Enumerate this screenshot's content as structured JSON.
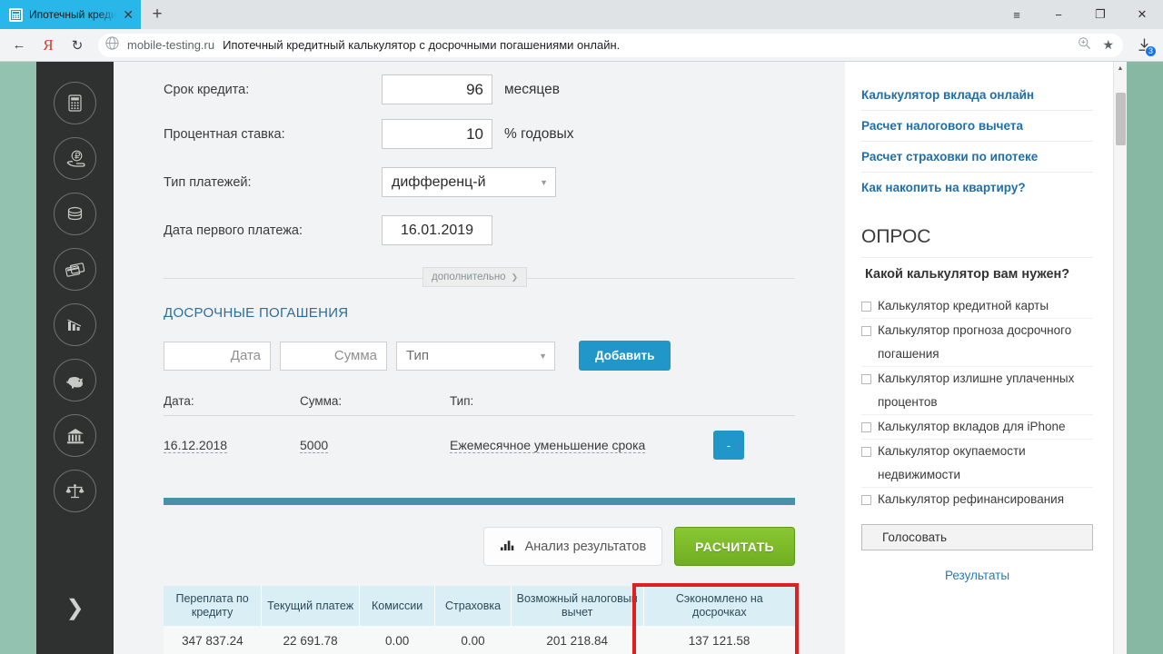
{
  "browser": {
    "tab": {
      "title": "Ипотечный кредитный",
      "favicon_icon": "calculator-icon",
      "close_icon": "✕"
    },
    "newtab_label": "+",
    "window_controls": {
      "menu": "≡",
      "minimize": "−",
      "maximize": "❐",
      "close": "✕"
    },
    "toolbar": {
      "back_icon": "←",
      "yandex_icon": "Я",
      "reload_icon": "↻",
      "site_icon": "globe-icon",
      "domain": "mobile-testing.ru",
      "page_title": "Ипотечный кредитный калькулятор с досрочными погашениями онлайн.",
      "zoom_icon": "search-plus-icon",
      "bookmark_icon": "★",
      "download_icon": "download-icon",
      "download_badge": "3"
    }
  },
  "rail": {
    "items": [
      {
        "icon": "calculator-icon"
      },
      {
        "icon": "hand-ruble-icon"
      },
      {
        "icon": "coins-icon"
      },
      {
        "icon": "credit-cards-icon"
      },
      {
        "icon": "bar-chart-icon"
      },
      {
        "icon": "piggy-bank-icon"
      },
      {
        "icon": "bank-building-icon"
      },
      {
        "icon": "scales-icon"
      }
    ],
    "expand_icon": "chevron-right-icon"
  },
  "form": {
    "term": {
      "label": "Срок кредита:",
      "value": "96",
      "suffix": "месяцев"
    },
    "rate": {
      "label": "Процентная ставка:",
      "value": "10",
      "suffix": "% годовых"
    },
    "payment_type": {
      "label": "Тип платежей:",
      "value": "дифференц-й"
    },
    "first_payment_date": {
      "label": "Дата первого платежа:",
      "value": "16.01.2019"
    },
    "additional_toggle": "дополнительно"
  },
  "early_payments": {
    "section_title": "ДОСРОЧНЫЕ ПОГАШЕНИЯ",
    "add_form": {
      "date_placeholder": "Дата",
      "sum_placeholder": "Сумма",
      "type_placeholder": "Тип",
      "add_button": "Добавить"
    },
    "headers": {
      "date": "Дата:",
      "sum": "Сумма:",
      "type": "Тип:"
    },
    "rows": [
      {
        "date": "16.12.2018",
        "sum": "5000",
        "type": "Ежемесячное уменьшение срока",
        "remove": "-"
      }
    ]
  },
  "actions": {
    "analysis_label": "Анализ результатов",
    "analysis_icon": "bar-chart-icon",
    "calculate_label": "РАСЧИТАТЬ"
  },
  "results": {
    "headers": [
      "Переплата по кредиту",
      "Текущий платеж",
      "Комиссии",
      "Страховка",
      "Возможный налоговый вычет",
      "Сэкономлено на досрочках"
    ],
    "values": [
      "347 837.24",
      "22 691.78",
      "0.00",
      "0.00",
      "201 218.84",
      "137 121.58"
    ],
    "highlight_color": "#e02020",
    "highlighted_column_index": 5
  },
  "sidebar": {
    "links": [
      "Калькулятор вклада онлайн",
      "Расчет налогового вычета",
      "Расчет страховки по ипотеке",
      "Как накопить на квартиру?"
    ],
    "poll": {
      "heading": "ОПРОС",
      "question": "Какой калькулятор вам нужен?",
      "options": [
        "Калькулятор кредитной карты",
        "Калькулятор прогноза досрочного погашения",
        "Калькулятор излишне уплаченных процентов",
        "Калькулятор вкладов для iPhone",
        "Калькулятор окупаемости недвижимости",
        "Калькулятор рефинансирования"
      ],
      "vote_button": "Голосовать",
      "results_link": "Результаты"
    }
  }
}
